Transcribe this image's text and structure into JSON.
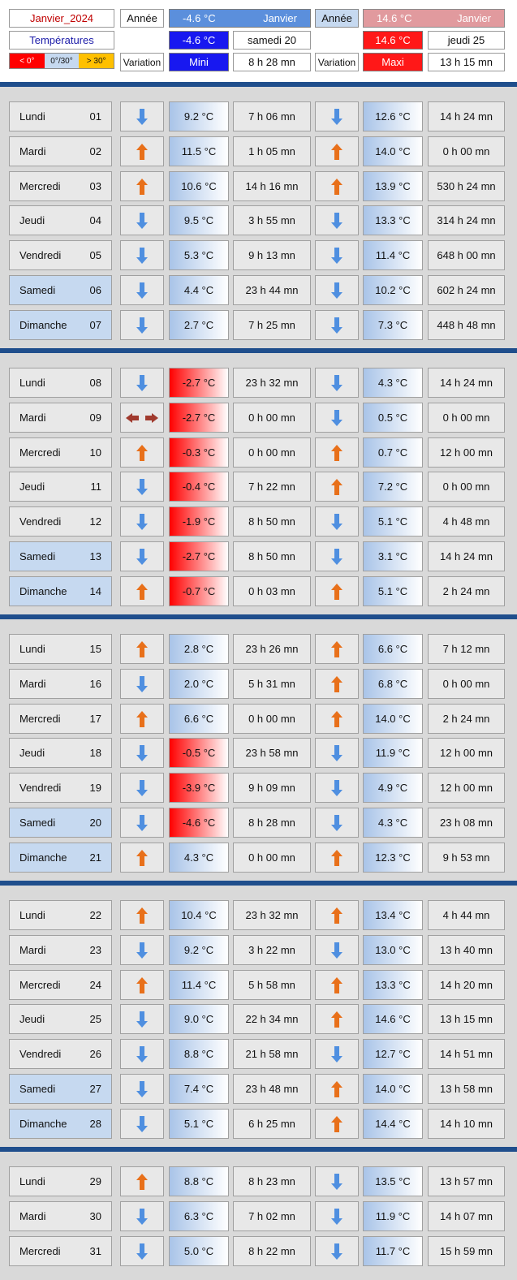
{
  "header": {
    "month_label": "Janvier_2024",
    "section_label": "Températures",
    "legend": {
      "below_zero": "< 0°",
      "mid_range": "0°/30°",
      "above_30": "> 30°"
    },
    "annee_label_1": "Année",
    "annee_label_2": "Année",
    "variation_label_1": "Variation",
    "variation_label_2": "Variation",
    "min_record": {
      "value": "-4.6 °C",
      "month": "Janvier",
      "value_2": "-4.6 °C",
      "day": "samedi 20",
      "label": "Mini",
      "duration": "8 h 28 mn"
    },
    "max_record": {
      "value": "14.6 °C",
      "month": "Janvier",
      "value_2": "14.6 °C",
      "day": "jeudi 25",
      "label": "Maxi",
      "duration": "13 h 15 mn"
    }
  },
  "colors": {
    "arrow_down": "#4f8fe0",
    "arrow_up": "#e8701a",
    "arrow_flat": "#a03a2e",
    "negative_temp": "#ff0000",
    "positive_temp": "#a9c4e8",
    "weekend": "#c6d9f0",
    "separator": "#1f4e8c"
  },
  "weeks": [
    {
      "days": [
        {
          "day": "Lundi",
          "num": "01",
          "min_trend": "down",
          "min": "9.2 °C",
          "min_dur": "7 h 06 mn",
          "max_trend": "down",
          "max": "12.6 °C",
          "max_dur": "14 h 24 mn",
          "weekend": false
        },
        {
          "day": "Mardi",
          "num": "02",
          "min_trend": "up",
          "min": "11.5 °C",
          "min_dur": "1 h 05 mn",
          "max_trend": "up",
          "max": "14.0 °C",
          "max_dur": "0 h 00 mn",
          "weekend": false
        },
        {
          "day": "Mercredi",
          "num": "03",
          "min_trend": "up",
          "min": "10.6 °C",
          "min_dur": "14 h 16 mn",
          "max_trend": "up",
          "max": "13.9 °C",
          "max_dur": "530 h 24 mn",
          "weekend": false
        },
        {
          "day": "Jeudi",
          "num": "04",
          "min_trend": "down",
          "min": "9.5 °C",
          "min_dur": "3 h 55 mn",
          "max_trend": "down",
          "max": "13.3 °C",
          "max_dur": "314 h 24 mn",
          "weekend": false
        },
        {
          "day": "Vendredi",
          "num": "05",
          "min_trend": "down",
          "min": "5.3 °C",
          "min_dur": "9 h 13 mn",
          "max_trend": "down",
          "max": "11.4 °C",
          "max_dur": "648 h 00 mn",
          "weekend": false
        },
        {
          "day": "Samedi",
          "num": "06",
          "min_trend": "down",
          "min": "4.4 °C",
          "min_dur": "23 h 44 mn",
          "max_trend": "down",
          "max": "10.2 °C",
          "max_dur": "602 h 24 mn",
          "weekend": true
        },
        {
          "day": "Dimanche",
          "num": "07",
          "min_trend": "down",
          "min": "2.7 °C",
          "min_dur": "7 h 25 mn",
          "max_trend": "down",
          "max": "7.3 °C",
          "max_dur": "448 h 48 mn",
          "weekend": true
        }
      ]
    },
    {
      "days": [
        {
          "day": "Lundi",
          "num": "08",
          "min_trend": "down",
          "min": "-2.7 °C",
          "min_dur": "23 h 32 mn",
          "max_trend": "down",
          "max": "4.3 °C",
          "max_dur": "14 h 24 mn",
          "weekend": false
        },
        {
          "day": "Mardi",
          "num": "09",
          "min_trend": "flat",
          "min": "-2.7 °C",
          "min_dur": "0 h 00 mn",
          "max_trend": "down",
          "max": "0.5 °C",
          "max_dur": "0 h 00 mn",
          "weekend": false
        },
        {
          "day": "Mercredi",
          "num": "10",
          "min_trend": "up",
          "min": "-0.3 °C",
          "min_dur": "0 h 00 mn",
          "max_trend": "up",
          "max": "0.7 °C",
          "max_dur": "12 h 00 mn",
          "weekend": false
        },
        {
          "day": "Jeudi",
          "num": "11",
          "min_trend": "down",
          "min": "-0.4 °C",
          "min_dur": "7 h 22 mn",
          "max_trend": "up",
          "max": "7.2 °C",
          "max_dur": "0 h 00 mn",
          "weekend": false
        },
        {
          "day": "Vendredi",
          "num": "12",
          "min_trend": "down",
          "min": "-1.9 °C",
          "min_dur": "8 h 50 mn",
          "max_trend": "down",
          "max": "5.1 °C",
          "max_dur": "4 h 48 mn",
          "weekend": false
        },
        {
          "day": "Samedi",
          "num": "13",
          "min_trend": "down",
          "min": "-2.7 °C",
          "min_dur": "8 h 50 mn",
          "max_trend": "down",
          "max": "3.1 °C",
          "max_dur": "14 h 24 mn",
          "weekend": true
        },
        {
          "day": "Dimanche",
          "num": "14",
          "min_trend": "up",
          "min": "-0.7 °C",
          "min_dur": "0 h 03 mn",
          "max_trend": "up",
          "max": "5.1 °C",
          "max_dur": "2 h 24 mn",
          "weekend": true
        }
      ]
    },
    {
      "days": [
        {
          "day": "Lundi",
          "num": "15",
          "min_trend": "up",
          "min": "2.8 °C",
          "min_dur": "23 h 26 mn",
          "max_trend": "up",
          "max": "6.6 °C",
          "max_dur": "7 h 12 mn",
          "weekend": false
        },
        {
          "day": "Mardi",
          "num": "16",
          "min_trend": "down",
          "min": "2.0 °C",
          "min_dur": "5 h 31 mn",
          "max_trend": "up",
          "max": "6.8 °C",
          "max_dur": "0 h 00 mn",
          "weekend": false
        },
        {
          "day": "Mercredi",
          "num": "17",
          "min_trend": "up",
          "min": "6.6 °C",
          "min_dur": "0 h 00 mn",
          "max_trend": "up",
          "max": "14.0 °C",
          "max_dur": "2 h 24 mn",
          "weekend": false
        },
        {
          "day": "Jeudi",
          "num": "18",
          "min_trend": "down",
          "min": "-0.5 °C",
          "min_dur": "23 h 58 mn",
          "max_trend": "down",
          "max": "11.9 °C",
          "max_dur": "12 h 00 mn",
          "weekend": false
        },
        {
          "day": "Vendredi",
          "num": "19",
          "min_trend": "down",
          "min": "-3.9 °C",
          "min_dur": "9 h 09 mn",
          "max_trend": "down",
          "max": "4.9 °C",
          "max_dur": "12 h 00 mn",
          "weekend": false
        },
        {
          "day": "Samedi",
          "num": "20",
          "min_trend": "down",
          "min": "-4.6 °C",
          "min_dur": "8 h 28 mn",
          "max_trend": "down",
          "max": "4.3 °C",
          "max_dur": "23 h 08 mn",
          "weekend": true
        },
        {
          "day": "Dimanche",
          "num": "21",
          "min_trend": "up",
          "min": "4.3 °C",
          "min_dur": "0 h 00 mn",
          "max_trend": "up",
          "max": "12.3 °C",
          "max_dur": "9 h 53 mn",
          "weekend": true
        }
      ]
    },
    {
      "days": [
        {
          "day": "Lundi",
          "num": "22",
          "min_trend": "up",
          "min": "10.4 °C",
          "min_dur": "23 h 32 mn",
          "max_trend": "up",
          "max": "13.4 °C",
          "max_dur": "4 h 44 mn",
          "weekend": false
        },
        {
          "day": "Mardi",
          "num": "23",
          "min_trend": "down",
          "min": "9.2 °C",
          "min_dur": "3 h 22 mn",
          "max_trend": "down",
          "max": "13.0 °C",
          "max_dur": "13 h 40 mn",
          "weekend": false
        },
        {
          "day": "Mercredi",
          "num": "24",
          "min_trend": "up",
          "min": "11.4 °C",
          "min_dur": "5 h 58 mn",
          "max_trend": "up",
          "max": "13.3 °C",
          "max_dur": "14 h 20 mn",
          "weekend": false
        },
        {
          "day": "Jeudi",
          "num": "25",
          "min_trend": "down",
          "min": "9.0 °C",
          "min_dur": "22 h 34 mn",
          "max_trend": "up",
          "max": "14.6 °C",
          "max_dur": "13 h 15 mn",
          "weekend": false
        },
        {
          "day": "Vendredi",
          "num": "26",
          "min_trend": "down",
          "min": "8.8 °C",
          "min_dur": "21 h 58 mn",
          "max_trend": "down",
          "max": "12.7 °C",
          "max_dur": "14 h 51 mn",
          "weekend": false
        },
        {
          "day": "Samedi",
          "num": "27",
          "min_trend": "down",
          "min": "7.4 °C",
          "min_dur": "23 h 48 mn",
          "max_trend": "up",
          "max": "14.0 °C",
          "max_dur": "13 h 58 mn",
          "weekend": true
        },
        {
          "day": "Dimanche",
          "num": "28",
          "min_trend": "down",
          "min": "5.1 °C",
          "min_dur": "6 h 25 mn",
          "max_trend": "up",
          "max": "14.4 °C",
          "max_dur": "14 h 10 mn",
          "weekend": true
        }
      ]
    },
    {
      "days": [
        {
          "day": "Lundi",
          "num": "29",
          "min_trend": "up",
          "min": "8.8 °C",
          "min_dur": "8 h 23 mn",
          "max_trend": "down",
          "max": "13.5 °C",
          "max_dur": "13 h 57 mn",
          "weekend": false
        },
        {
          "day": "Mardi",
          "num": "30",
          "min_trend": "down",
          "min": "6.3 °C",
          "min_dur": "7 h 02 mn",
          "max_trend": "down",
          "max": "11.9 °C",
          "max_dur": "14 h 07 mn",
          "weekend": false
        },
        {
          "day": "Mercredi",
          "num": "31",
          "min_trend": "down",
          "min": "5.0 °C",
          "min_dur": "8 h 22 mn",
          "max_trend": "down",
          "max": "11.7 °C",
          "max_dur": "15 h 59 mn",
          "weekend": false
        }
      ]
    }
  ]
}
